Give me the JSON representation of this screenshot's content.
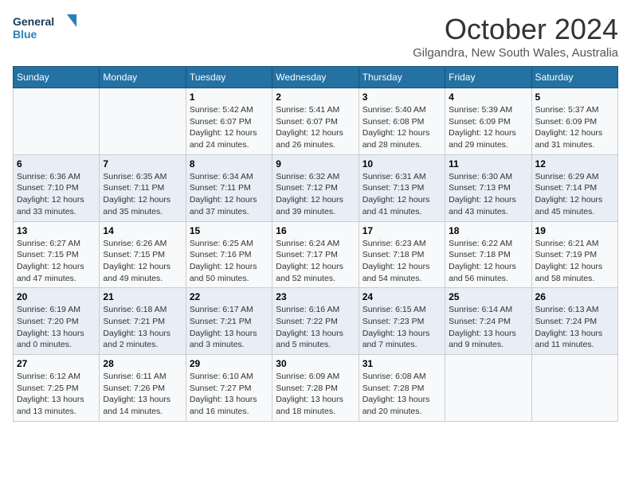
{
  "logo": {
    "line1": "General",
    "line2": "Blue"
  },
  "title": "October 2024",
  "subtitle": "Gilgandra, New South Wales, Australia",
  "headers": [
    "Sunday",
    "Monday",
    "Tuesday",
    "Wednesday",
    "Thursday",
    "Friday",
    "Saturday"
  ],
  "weeks": [
    [
      {
        "day": "",
        "info": ""
      },
      {
        "day": "",
        "info": ""
      },
      {
        "day": "1",
        "info": "Sunrise: 5:42 AM\nSunset: 6:07 PM\nDaylight: 12 hours\nand 24 minutes."
      },
      {
        "day": "2",
        "info": "Sunrise: 5:41 AM\nSunset: 6:07 PM\nDaylight: 12 hours\nand 26 minutes."
      },
      {
        "day": "3",
        "info": "Sunrise: 5:40 AM\nSunset: 6:08 PM\nDaylight: 12 hours\nand 28 minutes."
      },
      {
        "day": "4",
        "info": "Sunrise: 5:39 AM\nSunset: 6:09 PM\nDaylight: 12 hours\nand 29 minutes."
      },
      {
        "day": "5",
        "info": "Sunrise: 5:37 AM\nSunset: 6:09 PM\nDaylight: 12 hours\nand 31 minutes."
      }
    ],
    [
      {
        "day": "6",
        "info": "Sunrise: 6:36 AM\nSunset: 7:10 PM\nDaylight: 12 hours\nand 33 minutes."
      },
      {
        "day": "7",
        "info": "Sunrise: 6:35 AM\nSunset: 7:11 PM\nDaylight: 12 hours\nand 35 minutes."
      },
      {
        "day": "8",
        "info": "Sunrise: 6:34 AM\nSunset: 7:11 PM\nDaylight: 12 hours\nand 37 minutes."
      },
      {
        "day": "9",
        "info": "Sunrise: 6:32 AM\nSunset: 7:12 PM\nDaylight: 12 hours\nand 39 minutes."
      },
      {
        "day": "10",
        "info": "Sunrise: 6:31 AM\nSunset: 7:13 PM\nDaylight: 12 hours\nand 41 minutes."
      },
      {
        "day": "11",
        "info": "Sunrise: 6:30 AM\nSunset: 7:13 PM\nDaylight: 12 hours\nand 43 minutes."
      },
      {
        "day": "12",
        "info": "Sunrise: 6:29 AM\nSunset: 7:14 PM\nDaylight: 12 hours\nand 45 minutes."
      }
    ],
    [
      {
        "day": "13",
        "info": "Sunrise: 6:27 AM\nSunset: 7:15 PM\nDaylight: 12 hours\nand 47 minutes."
      },
      {
        "day": "14",
        "info": "Sunrise: 6:26 AM\nSunset: 7:15 PM\nDaylight: 12 hours\nand 49 minutes."
      },
      {
        "day": "15",
        "info": "Sunrise: 6:25 AM\nSunset: 7:16 PM\nDaylight: 12 hours\nand 50 minutes."
      },
      {
        "day": "16",
        "info": "Sunrise: 6:24 AM\nSunset: 7:17 PM\nDaylight: 12 hours\nand 52 minutes."
      },
      {
        "day": "17",
        "info": "Sunrise: 6:23 AM\nSunset: 7:18 PM\nDaylight: 12 hours\nand 54 minutes."
      },
      {
        "day": "18",
        "info": "Sunrise: 6:22 AM\nSunset: 7:18 PM\nDaylight: 12 hours\nand 56 minutes."
      },
      {
        "day": "19",
        "info": "Sunrise: 6:21 AM\nSunset: 7:19 PM\nDaylight: 12 hours\nand 58 minutes."
      }
    ],
    [
      {
        "day": "20",
        "info": "Sunrise: 6:19 AM\nSunset: 7:20 PM\nDaylight: 13 hours\nand 0 minutes."
      },
      {
        "day": "21",
        "info": "Sunrise: 6:18 AM\nSunset: 7:21 PM\nDaylight: 13 hours\nand 2 minutes."
      },
      {
        "day": "22",
        "info": "Sunrise: 6:17 AM\nSunset: 7:21 PM\nDaylight: 13 hours\nand 3 minutes."
      },
      {
        "day": "23",
        "info": "Sunrise: 6:16 AM\nSunset: 7:22 PM\nDaylight: 13 hours\nand 5 minutes."
      },
      {
        "day": "24",
        "info": "Sunrise: 6:15 AM\nSunset: 7:23 PM\nDaylight: 13 hours\nand 7 minutes."
      },
      {
        "day": "25",
        "info": "Sunrise: 6:14 AM\nSunset: 7:24 PM\nDaylight: 13 hours\nand 9 minutes."
      },
      {
        "day": "26",
        "info": "Sunrise: 6:13 AM\nSunset: 7:24 PM\nDaylight: 13 hours\nand 11 minutes."
      }
    ],
    [
      {
        "day": "27",
        "info": "Sunrise: 6:12 AM\nSunset: 7:25 PM\nDaylight: 13 hours\nand 13 minutes."
      },
      {
        "day": "28",
        "info": "Sunrise: 6:11 AM\nSunset: 7:26 PM\nDaylight: 13 hours\nand 14 minutes."
      },
      {
        "day": "29",
        "info": "Sunrise: 6:10 AM\nSunset: 7:27 PM\nDaylight: 13 hours\nand 16 minutes."
      },
      {
        "day": "30",
        "info": "Sunrise: 6:09 AM\nSunset: 7:28 PM\nDaylight: 13 hours\nand 18 minutes."
      },
      {
        "day": "31",
        "info": "Sunrise: 6:08 AM\nSunset: 7:28 PM\nDaylight: 13 hours\nand 20 minutes."
      },
      {
        "day": "",
        "info": ""
      },
      {
        "day": "",
        "info": ""
      }
    ]
  ]
}
